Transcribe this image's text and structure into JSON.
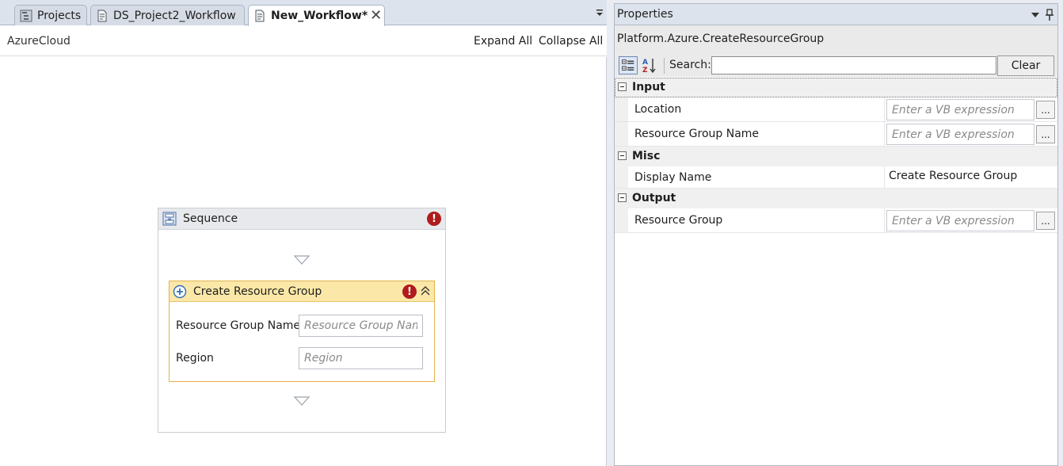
{
  "tabs": [
    {
      "label": "Projects",
      "icon": "project-tree-icon",
      "active": false
    },
    {
      "label": "DS_Project2_Workflow",
      "icon": "workflow-document-icon",
      "active": false
    },
    {
      "label": "New_Workflow*",
      "icon": "workflow-document-icon",
      "active": true,
      "close_symbol": "✕"
    }
  ],
  "designer": {
    "breadcrumb": "AzureCloud",
    "expand_all": "Expand All",
    "collapse_all": "Collapse All",
    "sequence": {
      "title": "Sequence",
      "error_symbol": "!",
      "activity": {
        "title": "Create Resource Group",
        "error_symbol": "!",
        "fields": [
          {
            "label": "Resource Group Name",
            "placeholder": "Resource Group Name"
          },
          {
            "label": "Region",
            "placeholder": "Region"
          }
        ]
      }
    }
  },
  "properties": {
    "title": "Properties",
    "type_name": "Platform.Azure.CreateResourceGroup",
    "search_label": "Search:",
    "search_value": "",
    "clear_label": "Clear",
    "categories": [
      {
        "name": "Input",
        "props": [
          {
            "name": "Location",
            "placeholder": "Enter a VB expression",
            "button": "..."
          },
          {
            "name": "Resource Group Name",
            "placeholder": "Enter a VB expression",
            "button": "..."
          }
        ]
      },
      {
        "name": "Misc",
        "props": [
          {
            "name": "Display Name",
            "value": "Create Resource Group"
          }
        ]
      },
      {
        "name": "Output",
        "props": [
          {
            "name": "Resource Group",
            "placeholder": "Enter a VB expression",
            "button": "..."
          }
        ]
      }
    ]
  },
  "colors": {
    "activity_header": "#fbe8a8",
    "activity_border": "#e3b24a",
    "error_red": "#b01b1b",
    "tab_strip": "#dde3ec"
  }
}
